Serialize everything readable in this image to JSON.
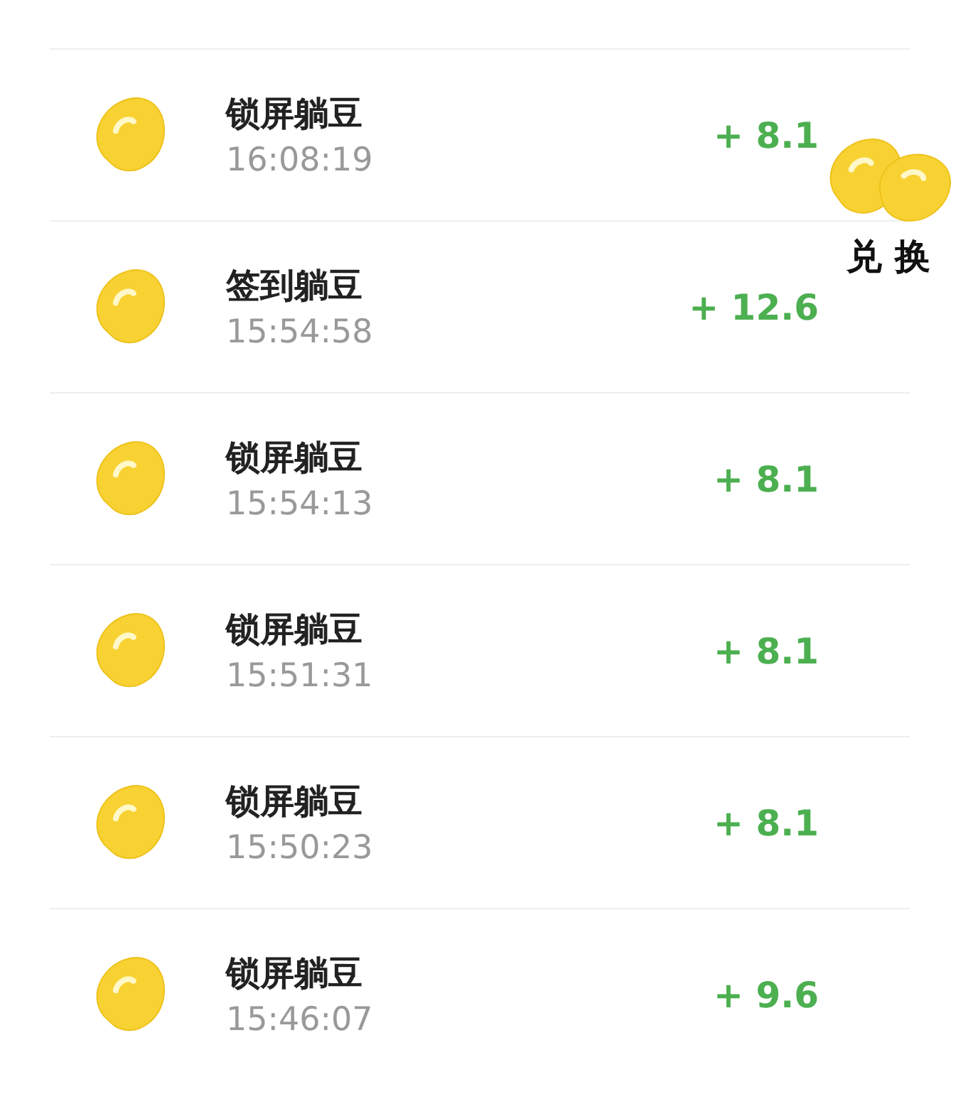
{
  "records": [
    {
      "title": "锁屏躺豆",
      "time": "16:08:19",
      "amount": "+ 8.1"
    },
    {
      "title": "签到躺豆",
      "time": "15:54:58",
      "amount": "+ 12.6"
    },
    {
      "title": "锁屏躺豆",
      "time": "15:54:13",
      "amount": "+ 8.1"
    },
    {
      "title": "锁屏躺豆",
      "time": "15:51:31",
      "amount": "+ 8.1"
    },
    {
      "title": "锁屏躺豆",
      "time": "15:50:23",
      "amount": "+ 8.1"
    },
    {
      "title": "锁屏躺豆",
      "time": "15:46:07",
      "amount": "+ 9.6"
    }
  ],
  "exchange_button": {
    "label": "兑 换"
  }
}
